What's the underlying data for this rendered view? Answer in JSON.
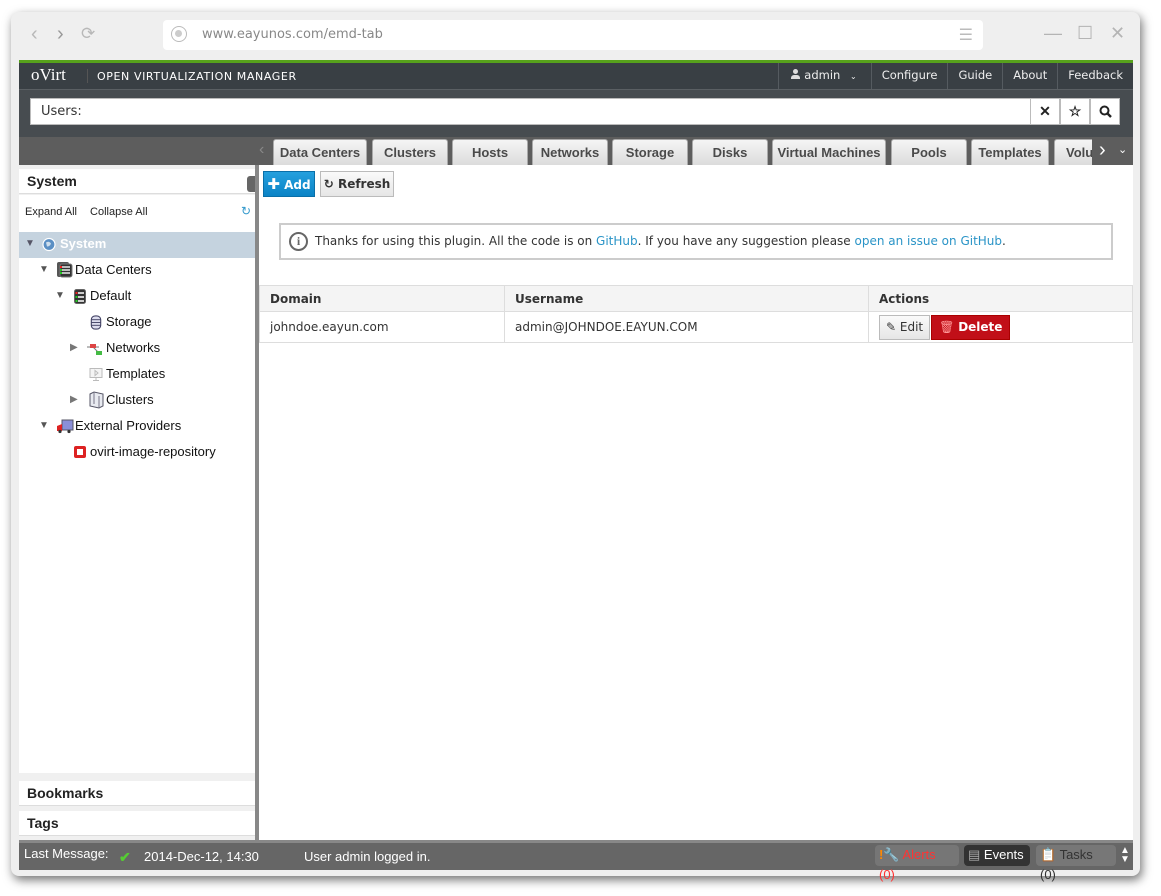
{
  "browser": {
    "url": "www.eayunos.com/emd-tab",
    "back_icon": "chevron-left",
    "forward_icon": "chevron-right",
    "reload_icon": "reload",
    "menu_icon": "hamburger"
  },
  "header": {
    "logo": "oVirt",
    "product": "OPEN VIRTUALIZATION MANAGER",
    "user": "admin",
    "links": [
      "Configure",
      "Guide",
      "About",
      "Feedback"
    ],
    "accent_color": "#57a21c"
  },
  "search": {
    "value": "Users:",
    "clear": "✕",
    "bookmark": "☆",
    "go": "🔍"
  },
  "tabs": [
    "Data Centers",
    "Clusters",
    "Hosts",
    "Networks",
    "Storage",
    "Disks",
    "Virtual Machines",
    "Pools",
    "Templates",
    "Volu"
  ],
  "sidebar": {
    "title": "System",
    "expand_all": "Expand All",
    "collapse_all": "Collapse All",
    "tree": [
      {
        "label": "System",
        "level": 0,
        "expanded": true,
        "selected": true,
        "icon": "globe"
      },
      {
        "label": "Data Centers",
        "level": 1,
        "expanded": true,
        "icon": "datacenters"
      },
      {
        "label": "Default",
        "level": 2,
        "expanded": true,
        "icon": "datacenter"
      },
      {
        "label": "Storage",
        "level": 3,
        "icon": "storage"
      },
      {
        "label": "Networks",
        "level": 3,
        "collapsed": true,
        "icon": "networks"
      },
      {
        "label": "Templates",
        "level": 3,
        "icon": "templates"
      },
      {
        "label": "Clusters",
        "level": 3,
        "collapsed": true,
        "icon": "clusters"
      },
      {
        "label": "External Providers",
        "level": 1,
        "expanded": true,
        "icon": "providers"
      },
      {
        "label": "ovirt-image-repository",
        "level": 2,
        "icon": "repository"
      }
    ],
    "bookmarks": "Bookmarks",
    "tags": "Tags"
  },
  "toolbar": {
    "add": "Add",
    "refresh": "Refresh"
  },
  "info": {
    "text1": "Thanks for using this plugin. All the code is on ",
    "link1": "GitHub",
    "text2": ". If you have any suggestion please ",
    "link2": "open an issue on GitHub",
    "text3": "."
  },
  "table": {
    "headers": [
      "Domain",
      "Username",
      "Actions"
    ],
    "rows": [
      {
        "domain": "johndoe.eayun.com",
        "username": "admin@JOHNDOE.EAYUN.COM",
        "edit": "Edit",
        "delete": "Delete"
      }
    ]
  },
  "footer": {
    "label": "Last Message:",
    "time": "2014-Dec-12, 14:30",
    "message": "User admin logged in.",
    "alerts": "Alerts (0)",
    "events": "Events",
    "tasks": "Tasks (0)"
  }
}
